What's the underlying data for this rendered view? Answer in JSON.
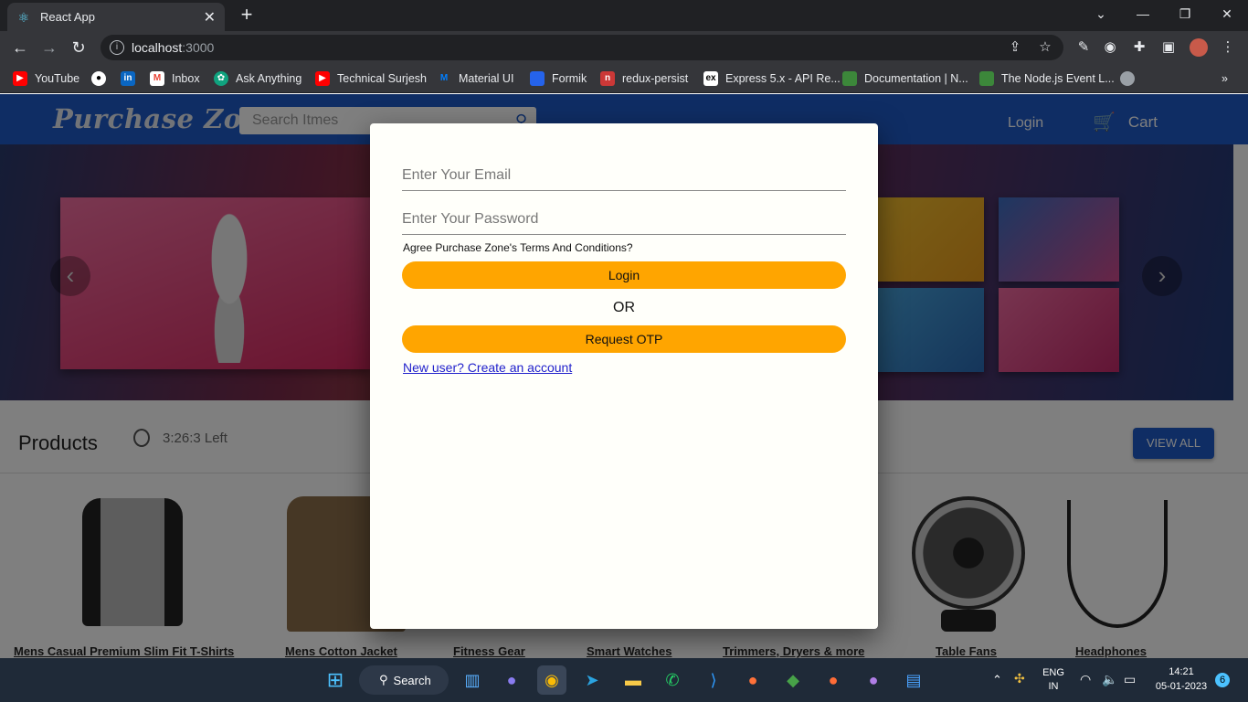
{
  "browser": {
    "tab_title": "React App",
    "url_host": "localhost",
    "url_port": ":3000"
  },
  "bookmarks": [
    {
      "label": "YouTube",
      "icon": "youtube-icon",
      "color": "#ff0000"
    },
    {
      "label": "",
      "icon": "github-icon",
      "color": "#ffffff"
    },
    {
      "label": "",
      "icon": "linkedin-icon",
      "color": "#0a66c2"
    },
    {
      "label": "Inbox",
      "icon": "gmail-icon",
      "color": "#ea4335"
    },
    {
      "label": "Ask Anything",
      "icon": "chatgpt-icon",
      "color": "#10a37f"
    },
    {
      "label": "Technical Surjesh",
      "icon": "youtube-icon",
      "color": "#ff0000"
    },
    {
      "label": "Material UI",
      "icon": "mui-icon",
      "color": "#007fff"
    },
    {
      "label": "Formik",
      "icon": "formik-icon",
      "color": "#2563eb"
    },
    {
      "label": "redux-persist",
      "icon": "npm-icon",
      "color": "#cb3837"
    },
    {
      "label": "Express 5.x - API Re...",
      "icon": "express-icon",
      "color": "#ffffff"
    },
    {
      "label": "Documentation | N...",
      "icon": "nodejs-icon",
      "color": "#3c873a"
    },
    {
      "label": "The Node.js Event L...",
      "icon": "nodejs-icon",
      "color": "#3c873a"
    }
  ],
  "header": {
    "logo": "Purchase Zone",
    "search_placeholder": "Search Itmes",
    "login": "Login",
    "cart": "Cart"
  },
  "products": {
    "title": "Products",
    "timer": "3:26:3 Left",
    "view_all": "VIEW ALL",
    "items": [
      "Mens Casual Premium Slim Fit T-Shirts",
      "Mens Cotton Jacket",
      "Fitness Gear",
      "Smart Watches",
      "Trimmers, Dryers & more",
      "Table Fans",
      "Headphones"
    ]
  },
  "login_modal": {
    "email_placeholder": "Enter Your Email",
    "password_placeholder": "Enter Your Password",
    "terms": "Agree Purchase Zone's Terms And Conditions?",
    "login_button": "Login",
    "or": "OR",
    "otp_button": "Request OTP",
    "signup_link": "New user? Create an account"
  },
  "taskbar": {
    "search": "Search",
    "lang_top": "ENG",
    "lang_bottom": "IN",
    "time": "14:21",
    "date": "05-01-2023",
    "notifications": "6"
  },
  "colors": {
    "header": "#1e5bc9",
    "accent_button": "#ffa500"
  }
}
